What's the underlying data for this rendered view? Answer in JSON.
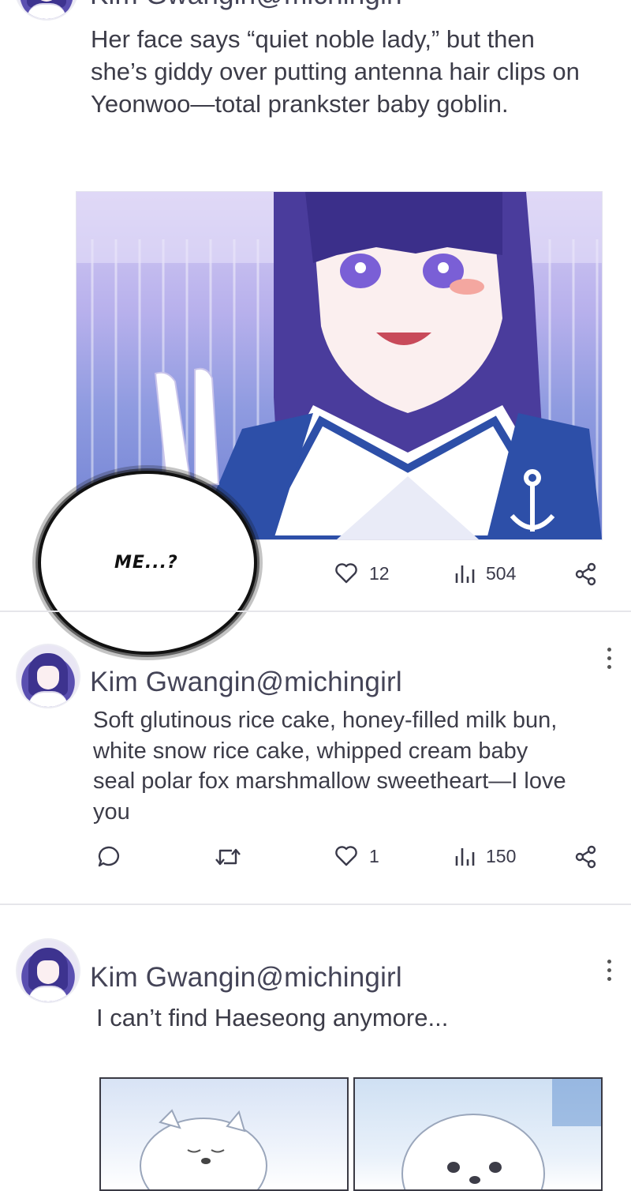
{
  "post1": {
    "name_partial": "Kim Gwangin@michingirl",
    "text": "Her face says “quiet noble lady,” but then she’s giddy over putting antenna hair clips on Yeonwoo—total prankster baby goblin.",
    "likes": "12",
    "views": "504"
  },
  "speech_bubble": {
    "text": "ME...?"
  },
  "post2": {
    "name": "Kim Gwangin",
    "handle": "@michingirl",
    "text": "Soft glutinous rice cake, honey-filled milk bun, white snow rice cake, whipped cream baby seal polar fox marshmallow sweetheart—I love you",
    "likes": "1",
    "views": "150"
  },
  "post3": {
    "name": "Kim Gwangin",
    "handle": "@michingirl",
    "text": "I can’t find Haeseong anymore..."
  },
  "icons": {
    "like": "heart-icon",
    "views": "bar-chart-icon",
    "share": "share-icon",
    "reply": "comment-icon",
    "repost": "repost-icon",
    "more": "kebab-menu-icon"
  },
  "colors": {
    "text": "#3c3c48",
    "name": "#444457",
    "divider": "#e6e6ea",
    "hair": "#3d338f",
    "uniform": "#2d4fa8"
  }
}
